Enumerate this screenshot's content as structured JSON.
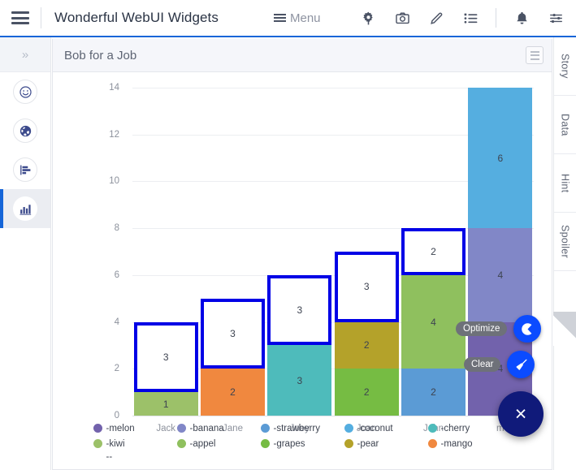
{
  "topbar": {
    "hamburger_icon": "hamburger-icon",
    "app_title": "Wonderful WebUI Widgets",
    "menu_label": "Menu",
    "icons": [
      {
        "name": "gear-icon"
      },
      {
        "name": "camera-icon"
      },
      {
        "name": "pencil-icon"
      },
      {
        "name": "list-icon"
      },
      {
        "name": "bell-icon"
      },
      {
        "name": "sliders-icon"
      }
    ]
  },
  "left_rail": {
    "expand_label": "»",
    "items": [
      {
        "name": "sidebar-item-smiley",
        "icon": "smiley-icon",
        "active": false
      },
      {
        "name": "sidebar-item-globe",
        "icon": "globe-icon",
        "active": false
      },
      {
        "name": "sidebar-item-bar-horizontal",
        "icon": "bar-chart-horizontal-icon",
        "active": false
      },
      {
        "name": "sidebar-item-bar-chart",
        "icon": "bar-chart-icon",
        "active": true
      }
    ]
  },
  "right_rail": {
    "tabs": [
      {
        "label": "Story"
      },
      {
        "label": "Data"
      },
      {
        "label": "Hint"
      },
      {
        "label": "Spoiler"
      }
    ]
  },
  "card": {
    "title": "Bob for a Job",
    "menu_icon": "hamburger-icon"
  },
  "fabs": {
    "optimize_label": "Optimize",
    "optimize_icon": "pacman-icon",
    "clear_label": "Clear",
    "clear_icon": "broom-icon",
    "close_label": "×",
    "close_icon": "close-icon",
    "mini_color": "#0b4bff",
    "main_color": "#101a7a",
    "tooltip_color": "#6e7179"
  },
  "chart_data": {
    "type": "bar",
    "subtype": "stacked",
    "title": "Bob for a Job",
    "xlabel": "",
    "ylabel": "",
    "ylim": [
      0,
      14
    ],
    "yticks": [
      0,
      2,
      4,
      6,
      8,
      10,
      12,
      14
    ],
    "grid": true,
    "legend_position": "bottom",
    "highlight_color": "#0000e6",
    "categories": [
      "Jack",
      "Jane",
      "Joey",
      "Joan",
      "John",
      "m"
    ],
    "legend": [
      {
        "label": "-melon",
        "color": "#7262ac"
      },
      {
        "label": "-kiwi",
        "color": "#9cc169"
      },
      {
        "label": "-banana",
        "color": "#8187c7"
      },
      {
        "label": "-appel",
        "color": "#8fc05e"
      },
      {
        "label": "-strawberry",
        "color": "#5b9bd5"
      },
      {
        "label": "-grapes",
        "color": "#76bc43"
      },
      {
        "label": "-coconut",
        "color": "#55aee0"
      },
      {
        "label": "-pear",
        "color": "#b4a22a"
      },
      {
        "label": "-cherry",
        "color": "#4ebbbb"
      },
      {
        "label": "-mango",
        "color": "#f0883f"
      }
    ],
    "legend_extra": "--",
    "bars": [
      {
        "category": "Jack",
        "total": 4,
        "segments": [
          {
            "series": "-kiwi",
            "value": 1,
            "color": "#9cc169",
            "highlighted": false
          },
          {
            "series": "",
            "value": 3,
            "color": "#ffffff",
            "highlighted": true
          }
        ]
      },
      {
        "category": "Jane",
        "total": 5,
        "segments": [
          {
            "series": "-mango",
            "value": 2,
            "color": "#f0883f",
            "highlighted": false
          },
          {
            "series": "",
            "value": 3,
            "color": "#ffffff",
            "highlighted": true
          }
        ]
      },
      {
        "category": "Joey",
        "total": 6,
        "segments": [
          {
            "series": "-cherry",
            "value": 3,
            "color": "#4ebbbb",
            "highlighted": false
          },
          {
            "series": "",
            "value": 3,
            "color": "#ffffff",
            "highlighted": true
          }
        ]
      },
      {
        "category": "Joan",
        "total": 7,
        "segments": [
          {
            "series": "-grapes",
            "value": 2,
            "color": "#76bc43",
            "highlighted": false
          },
          {
            "series": "-pear",
            "value": 2,
            "color": "#b4a22a",
            "highlighted": false
          },
          {
            "series": "",
            "value": 3,
            "color": "#ffffff",
            "highlighted": true
          }
        ]
      },
      {
        "category": "John",
        "total": 8,
        "segments": [
          {
            "series": "-strawberry",
            "value": 2,
            "color": "#5b9bd5",
            "highlighted": false
          },
          {
            "series": "-appel",
            "value": 4,
            "color": "#8fc05e",
            "highlighted": false
          },
          {
            "series": "",
            "value": 2,
            "color": "#ffffff",
            "highlighted": true
          }
        ]
      },
      {
        "category": "m",
        "total": 14,
        "segments": [
          {
            "series": "-melon",
            "value": 4,
            "color": "#7262ac",
            "highlighted": false
          },
          {
            "series": "-banana",
            "value": 4,
            "color": "#8187c7",
            "highlighted": false
          },
          {
            "series": "-coconut",
            "value": 6,
            "color": "#55aee0",
            "highlighted": false
          }
        ]
      }
    ]
  }
}
